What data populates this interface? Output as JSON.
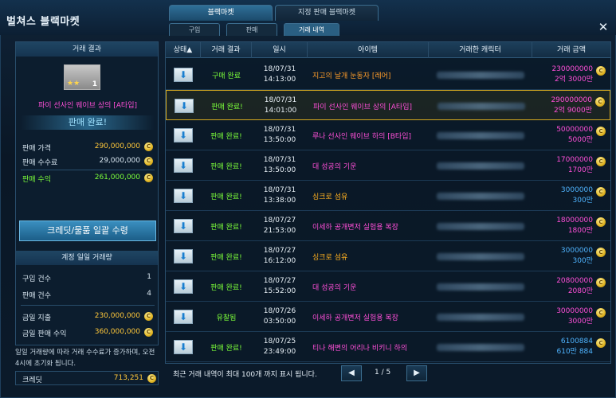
{
  "app": {
    "title": "벌쳐스 블랙마켓"
  },
  "top_tabs": [
    {
      "label": "블랙마켓"
    },
    {
      "label": "지정 판매 블랙마켓"
    }
  ],
  "sub_tabs": [
    {
      "label": "구입"
    },
    {
      "label": "판매"
    },
    {
      "label": "거래 내역"
    }
  ],
  "close_icon": "close-icon",
  "left_panel": {
    "result_header": "거래 결과",
    "item": {
      "count": "1",
      "stars": "★★",
      "name": "파이 선사인 웨이브 상의 [A타입]"
    },
    "sold_banner": "판매 완료!",
    "rows": [
      {
        "label": "판매 가격",
        "value": "290,000,000"
      },
      {
        "label": "판매 수수료",
        "value": "29,000,000"
      },
      {
        "label": "판매 수익",
        "value": "261,000,000"
      }
    ],
    "bulk_button": "크레딧/물품 일괄 수령",
    "daily_header": "계정 일일 거래량",
    "daily_rows": [
      {
        "label": "구입 건수",
        "value": "1"
      },
      {
        "label": "판매 건수",
        "value": "4"
      },
      {
        "label": "금일 지출",
        "value": "230,000,000"
      },
      {
        "label": "금일 판매 수익",
        "value": "360,000,000"
      }
    ],
    "note": "일일 거래량에 따라 거래 수수료가 증가하며, 오전 4시에 초기화 됩니다.",
    "credit_label": "크레딧",
    "credit_value": "713,251"
  },
  "table": {
    "headers": [
      "상태▲",
      "거래 결과",
      "일시",
      "아이템",
      "거래한 캐릭터",
      "거래 금액"
    ],
    "rows": [
      {
        "result": "구매 완료",
        "date": "18/07/31",
        "time": "14:13:00",
        "item": "지고의 날개 눈동자 [레어]",
        "item_color": "#ff9d2a",
        "price1": "230000000",
        "price2": "2억 3000만"
      },
      {
        "result": "판매 완료!",
        "date": "18/07/31",
        "time": "14:01:00",
        "item": "파이 선사인 웨이브 상의 [A타입]",
        "item_color": "#ff4fd8",
        "price1": "290000000",
        "price2": "2억 9000만"
      },
      {
        "result": "판매 완료!",
        "date": "18/07/31",
        "time": "13:50:00",
        "item": "루나 선사인 웨이브 하의 [B타입]",
        "item_color": "#ff4fd8",
        "price1": "50000000",
        "price2": "5000만"
      },
      {
        "result": "판매 완료!",
        "date": "18/07/31",
        "time": "13:50:00",
        "item": "대 성공의 기운",
        "item_color": "#ff4fd8",
        "price1": "17000000",
        "price2": "1700만"
      },
      {
        "result": "판매 완료!",
        "date": "18/07/31",
        "time": "13:38:00",
        "item": "싱크로 섬유",
        "item_color": "#ffb020",
        "price1": "3000000",
        "price2": "300만"
      },
      {
        "result": "판매 완료!",
        "date": "18/07/27",
        "time": "21:53:00",
        "item": "이세하 공개변저 실험용 복장",
        "item_color": "#ff4fd8",
        "price1": "18000000",
        "price2": "1800만"
      },
      {
        "result": "판매 완료!",
        "date": "18/07/27",
        "time": "16:12:00",
        "item": "싱크로 섬유",
        "item_color": "#ffb020",
        "price1": "3000000",
        "price2": "300만"
      },
      {
        "result": "판매 완료!",
        "date": "18/07/27",
        "time": "15:52:00",
        "item": "대 성공의 기운",
        "item_color": "#ff4fd8",
        "price1": "20800000",
        "price2": "2080만"
      },
      {
        "result": "유찰됨",
        "date": "18/07/26",
        "time": "03:50:00",
        "item": "이세하 공개변저 실험용 복장",
        "item_color": "#ff4fd8",
        "price1": "30000000",
        "price2": "3000만"
      },
      {
        "result": "판매 완료!",
        "date": "18/07/25",
        "time": "23:49:00",
        "item": "티나 해변의 어리나 비키니 하의",
        "item_color": "#ff4fd8",
        "price1": "6100884",
        "price2": "610만 884"
      }
    ]
  },
  "footer": {
    "text": "최근 거래 내역이 최대 100개 까지 표시 됩니다.",
    "page": "1 / 5"
  },
  "colors": {
    "green": "#7cff3a",
    "orange": "#ff9d2a",
    "magenta": "#ff4fd8",
    "price_magenta": "#ff4fd8",
    "price_blue": "#4fb4ff"
  }
}
